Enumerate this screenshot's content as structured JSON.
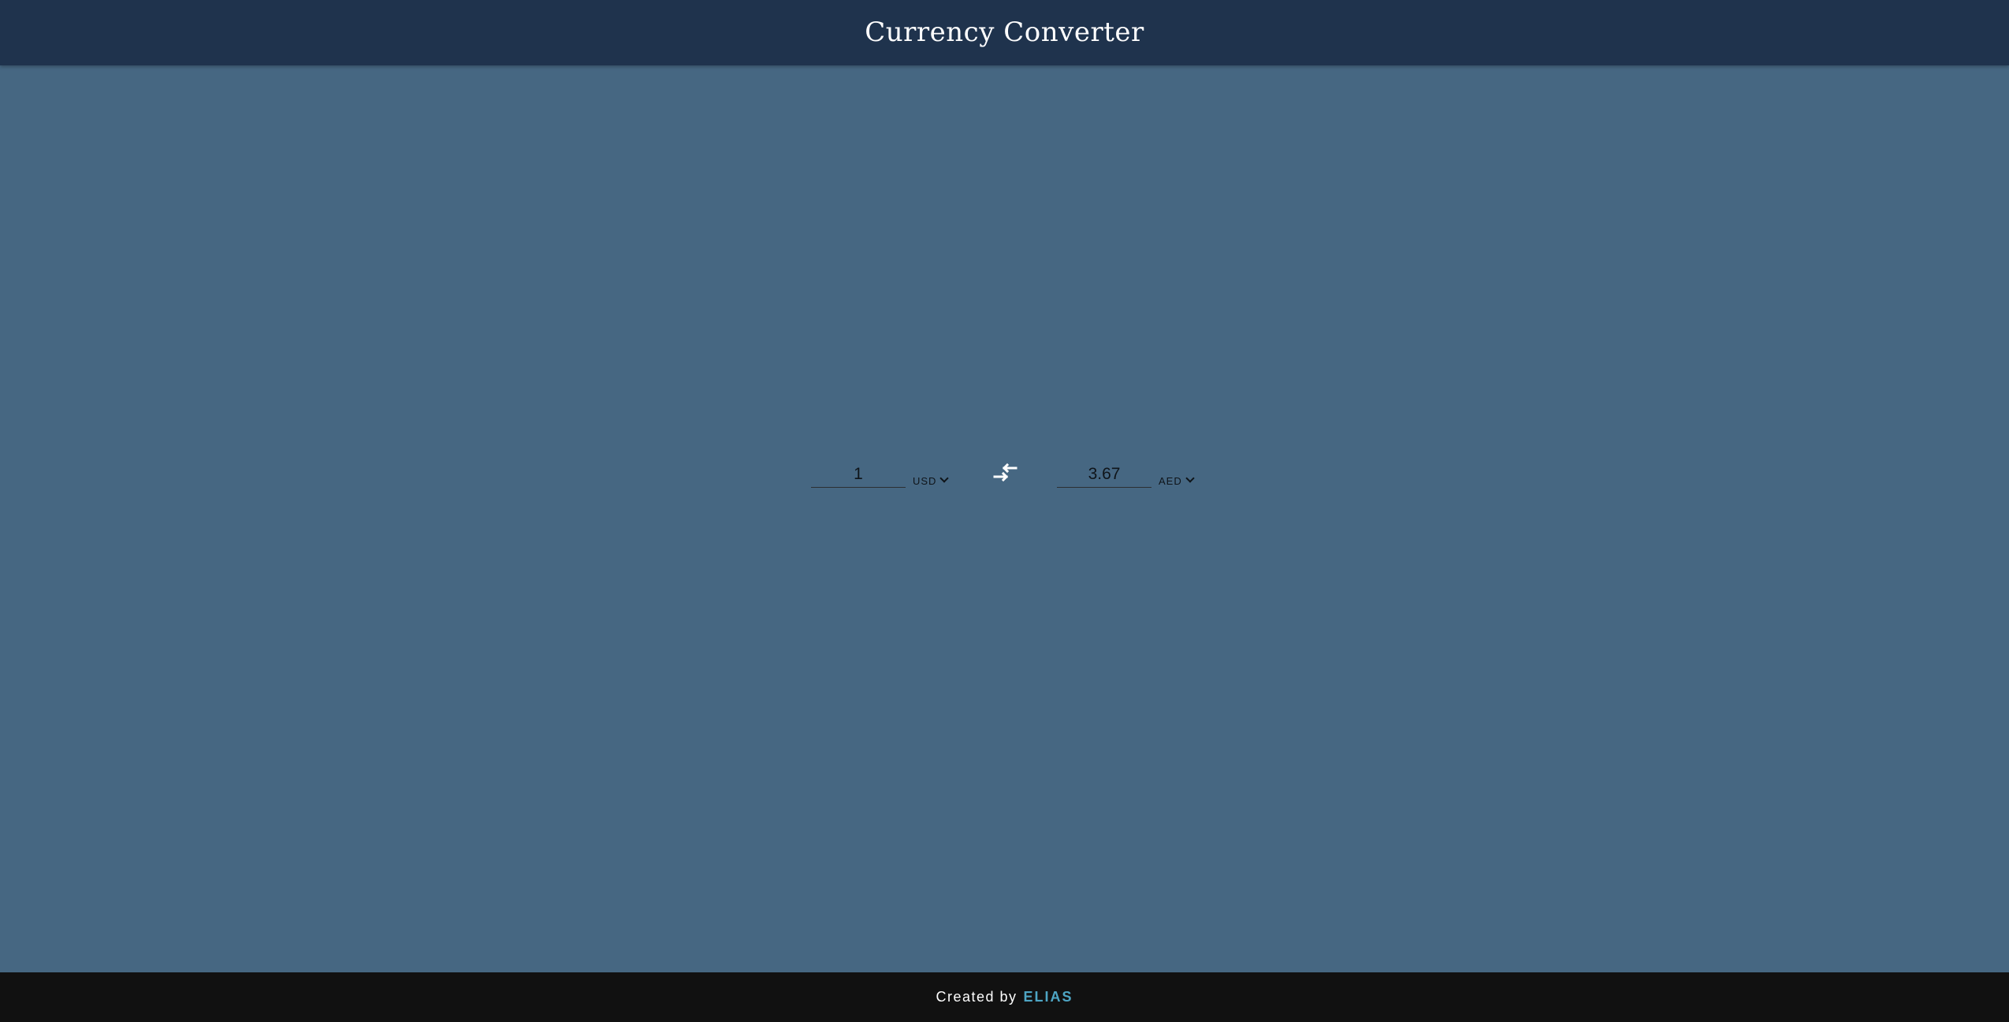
{
  "header": {
    "title": "Currency Converter"
  },
  "converter": {
    "from": {
      "amount": "1",
      "currency": "USD"
    },
    "to": {
      "amount": "3.67",
      "currency": "AED"
    },
    "swap_icon": "swap-arrows-icon"
  },
  "footer": {
    "created_by": "Created by",
    "author": "ELIAS"
  },
  "colors": {
    "header_bg": "#1f334d",
    "page_bg": "#466782",
    "footer_bg": "#111111",
    "author_accent": "#4ea5c4"
  }
}
